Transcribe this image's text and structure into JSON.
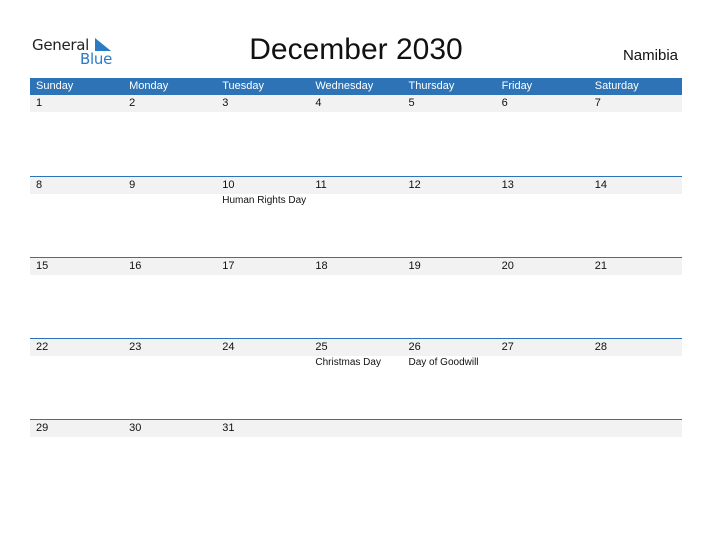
{
  "logo": {
    "line1": "General",
    "line2": "Blue",
    "icon": "triangle-flag-icon"
  },
  "title": "December 2030",
  "country": "Namibia",
  "colors": {
    "header_bg": "#2e73b5",
    "date_strip": "#f2f2f2",
    "logo_blue": "#2b7bc4"
  },
  "weekdays": [
    "Sunday",
    "Monday",
    "Tuesday",
    "Wednesday",
    "Thursday",
    "Friday",
    "Saturday"
  ],
  "weeks": [
    [
      {
        "day": "1",
        "event": ""
      },
      {
        "day": "2",
        "event": ""
      },
      {
        "day": "3",
        "event": ""
      },
      {
        "day": "4",
        "event": ""
      },
      {
        "day": "5",
        "event": ""
      },
      {
        "day": "6",
        "event": ""
      },
      {
        "day": "7",
        "event": ""
      }
    ],
    [
      {
        "day": "8",
        "event": ""
      },
      {
        "day": "9",
        "event": ""
      },
      {
        "day": "10",
        "event": "Human Rights Day"
      },
      {
        "day": "11",
        "event": ""
      },
      {
        "day": "12",
        "event": ""
      },
      {
        "day": "13",
        "event": ""
      },
      {
        "day": "14",
        "event": ""
      }
    ],
    [
      {
        "day": "15",
        "event": ""
      },
      {
        "day": "16",
        "event": ""
      },
      {
        "day": "17",
        "event": ""
      },
      {
        "day": "18",
        "event": ""
      },
      {
        "day": "19",
        "event": ""
      },
      {
        "day": "20",
        "event": ""
      },
      {
        "day": "21",
        "event": ""
      }
    ],
    [
      {
        "day": "22",
        "event": ""
      },
      {
        "day": "23",
        "event": ""
      },
      {
        "day": "24",
        "event": ""
      },
      {
        "day": "25",
        "event": "Christmas Day"
      },
      {
        "day": "26",
        "event": "Day of Goodwill"
      },
      {
        "day": "27",
        "event": ""
      },
      {
        "day": "28",
        "event": ""
      }
    ],
    [
      {
        "day": "29",
        "event": ""
      },
      {
        "day": "30",
        "event": ""
      },
      {
        "day": "31",
        "event": ""
      },
      {
        "day": "",
        "event": ""
      },
      {
        "day": "",
        "event": ""
      },
      {
        "day": "",
        "event": ""
      },
      {
        "day": "",
        "event": ""
      }
    ]
  ]
}
